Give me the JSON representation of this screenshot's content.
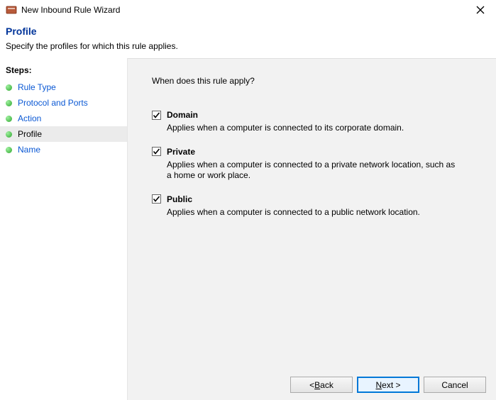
{
  "titlebar": {
    "title": "New Inbound Rule Wizard"
  },
  "header": {
    "title": "Profile",
    "subtitle": "Specify the profiles for which this rule applies."
  },
  "sidebar": {
    "heading": "Steps:",
    "steps": [
      {
        "label": "Rule Type"
      },
      {
        "label": "Protocol and Ports"
      },
      {
        "label": "Action"
      },
      {
        "label": "Profile"
      },
      {
        "label": "Name"
      }
    ]
  },
  "content": {
    "question": "When does this rule apply?",
    "profiles": [
      {
        "label": "Domain",
        "description": "Applies when a computer is connected to its corporate domain."
      },
      {
        "label": "Private",
        "description": "Applies when a computer is connected to a private network location, such as a home or work place."
      },
      {
        "label": "Public",
        "description": "Applies when a computer is connected to a public network location."
      }
    ]
  },
  "footer": {
    "back_pre": "< ",
    "back_u": "B",
    "back_post": "ack",
    "next_u": "N",
    "next_post": "ext >",
    "cancel": "Cancel"
  }
}
